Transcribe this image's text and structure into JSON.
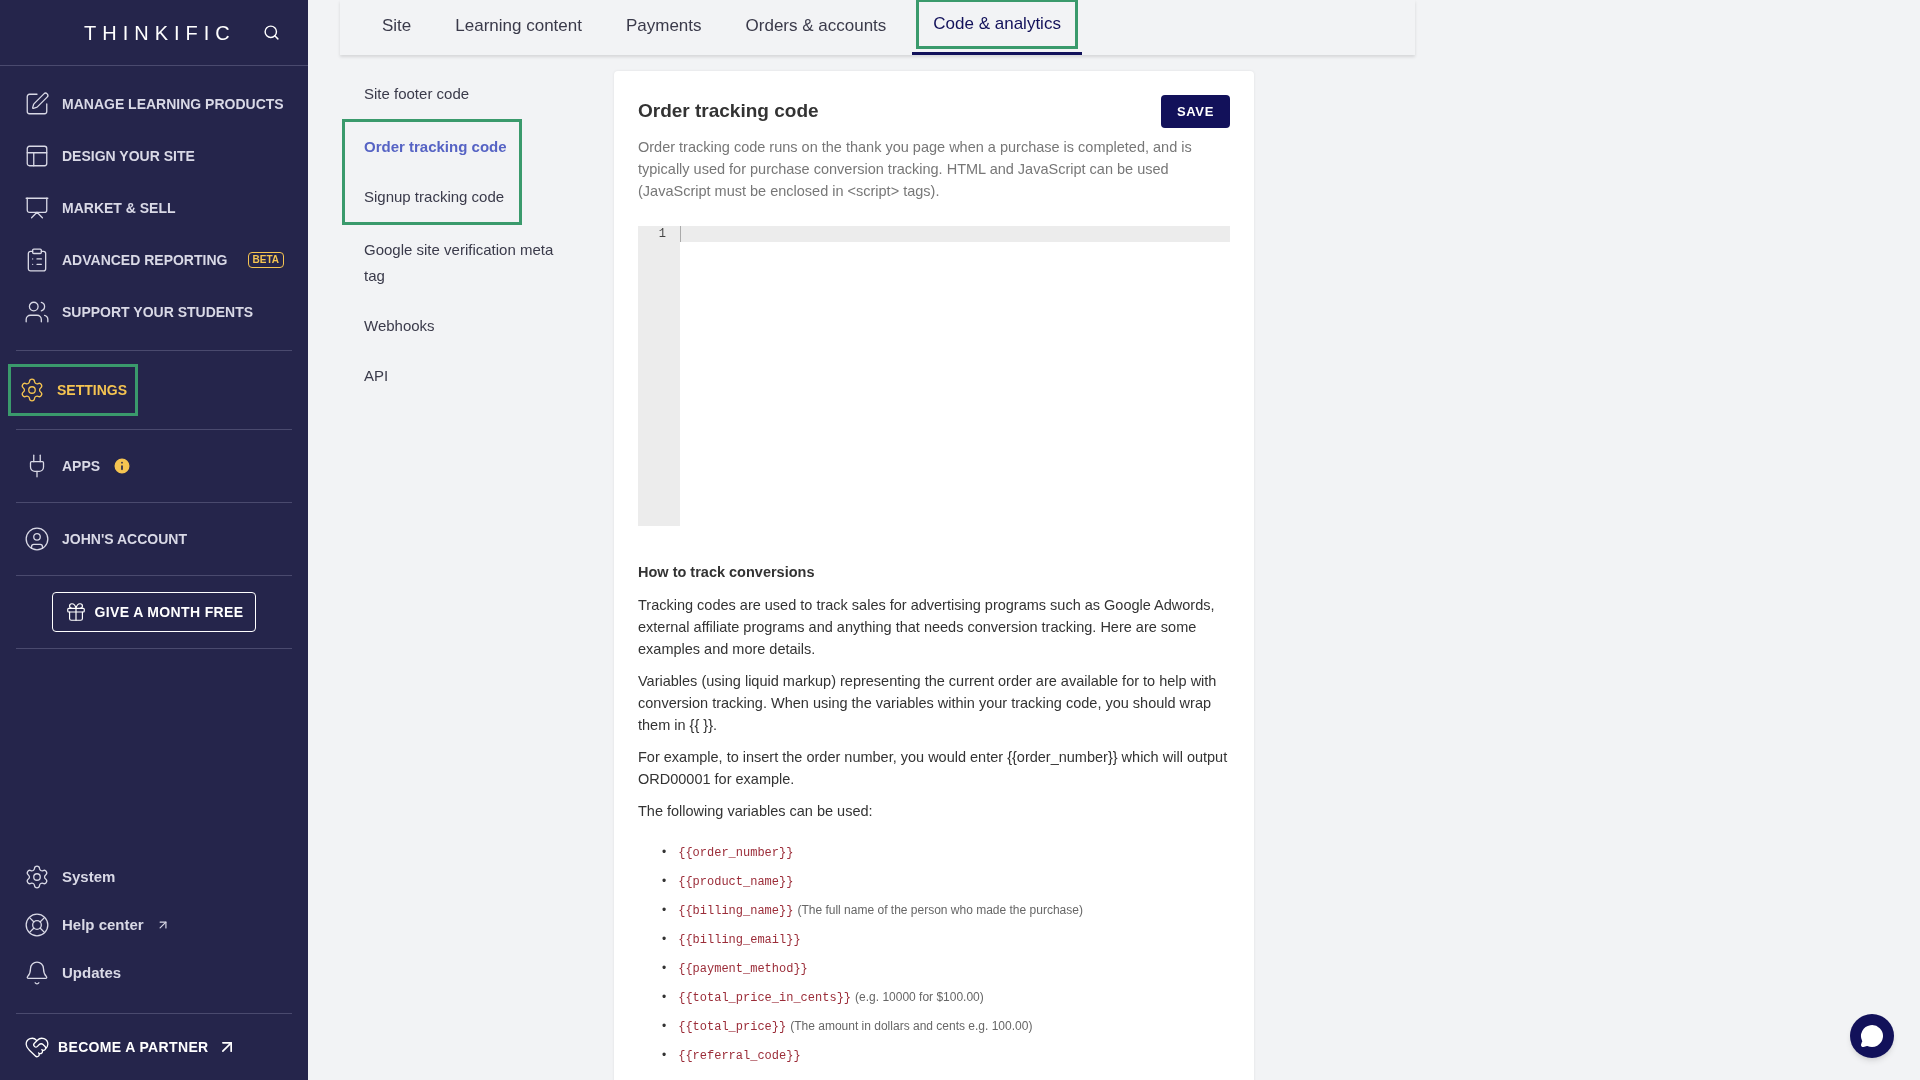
{
  "sidebar": {
    "logo": "THINKIFIC",
    "groups": [
      [
        {
          "label": "MANAGE LEARNING PRODUCTS",
          "selected": false,
          "highlighted": false
        },
        {
          "label": "DESIGN YOUR SITE",
          "selected": false,
          "highlighted": false
        },
        {
          "label": "MARKET & SELL",
          "selected": false,
          "highlighted": false
        },
        {
          "label": "ADVANCED REPORTING",
          "badge": "BETA",
          "selected": false,
          "highlighted": false
        },
        {
          "label": "SUPPORT YOUR STUDENTS",
          "selected": false,
          "highlighted": false
        }
      ],
      [
        {
          "label": "SETTINGS",
          "selected": true,
          "highlighted": true
        }
      ],
      [
        {
          "label": "APPS",
          "info": true,
          "selected": false,
          "highlighted": false
        }
      ],
      [
        {
          "label": "JOHN'S ACCOUNT",
          "selected": false,
          "highlighted": false
        }
      ]
    ],
    "gift_button": "GIVE A MONTH FREE",
    "bottom_items": [
      {
        "label": "System",
        "external": false
      },
      {
        "label": "Help center",
        "external": true
      },
      {
        "label": "Updates",
        "external": false
      }
    ],
    "partner_link": "BECOME A PARTNER"
  },
  "tabs": [
    {
      "label": "Site",
      "selected": false,
      "highlighted": false
    },
    {
      "label": "Learning content",
      "selected": false,
      "highlighted": false
    },
    {
      "label": "Payments",
      "selected": false,
      "highlighted": false
    },
    {
      "label": "Orders & accounts",
      "selected": false,
      "highlighted": false
    },
    {
      "label": "Code & analytics",
      "selected": true,
      "highlighted": true
    }
  ],
  "subnav": [
    {
      "label": "Site footer code",
      "selected": false,
      "highlighted": false
    },
    {
      "label": "Order tracking code",
      "selected": true,
      "highlighted": true
    },
    {
      "label": "Signup tracking code",
      "selected": false,
      "highlighted": true
    },
    {
      "label": "Google site verification meta tag",
      "selected": false,
      "highlighted": false
    },
    {
      "label": "Webhooks",
      "selected": false,
      "highlighted": false
    },
    {
      "label": "API",
      "selected": false,
      "highlighted": false
    }
  ],
  "card": {
    "title": "Order tracking code",
    "save_button": "SAVE",
    "description": "Order tracking code runs on the thank you page when a purchase is completed, and is typically used for purchase conversion tracking. HTML and JavaScript can be used (JavaScript must be enclosed in <script> tags).",
    "editor": {
      "line_numbers": [
        "1"
      ]
    },
    "help_title": "How to track conversions",
    "paragraphs": [
      "Tracking codes are used to track sales for advertising programs such as Google Adwords, external affiliate programs and anything that needs conversion tracking. Here are some examples and more details.",
      "Variables (using liquid markup) representing the current order are available for to help with conversion tracking. When using the variables within your tracking code, you should wrap them in {{ }}.",
      "For example, to insert the order number, you would enter {{order_number}} which will output ORD00001 for example.",
      "The following variables can be used:"
    ],
    "variables": [
      {
        "bullet": "•",
        "code": "{{order_number}}"
      },
      {
        "bullet": "•",
        "code": "{{product_name}}"
      },
      {
        "bullet": "•",
        "code": "{{billing_name}}",
        "note": "(The full name of the person who made the purchase)"
      },
      {
        "bullet": "•",
        "code": "{{billing_email}}"
      },
      {
        "bullet": "•",
        "code": "{{payment_method}}"
      },
      {
        "bullet": "•",
        "code": "{{total_price_in_cents}}",
        "note": "(e.g. 10000 for $100.00)"
      },
      {
        "bullet": "•",
        "code": "{{total_price}}",
        "note": "(The amount in dollars and cents e.g. 100.00)"
      },
      {
        "bullet": "•",
        "code": "{{referral_code}}"
      }
    ]
  }
}
